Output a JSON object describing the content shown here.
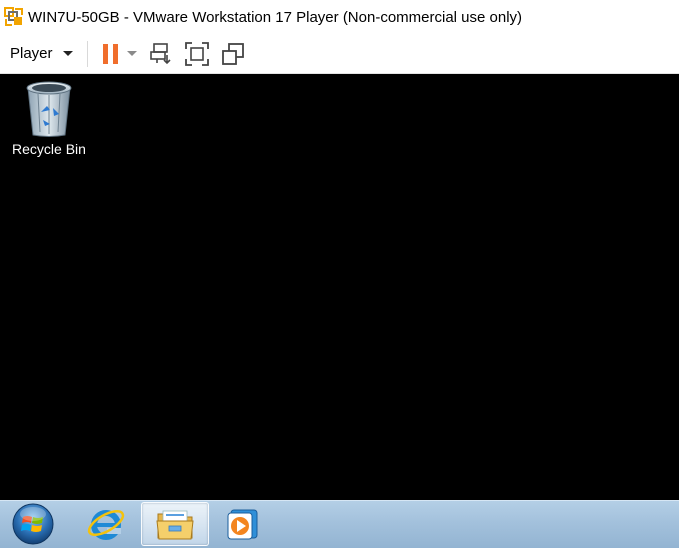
{
  "window": {
    "title": "WIN7U-50GB - VMware Workstation 17 Player (Non-commercial use only)",
    "app_icon": "vmware-player-icon"
  },
  "toolbar": {
    "player_menu_label": "Player",
    "buttons": [
      {
        "name": "pause-button",
        "icon": "pause-icon",
        "color": "#f06e2c"
      },
      {
        "name": "pause-dropdown-button",
        "icon": "chevron-down-icon"
      },
      {
        "name": "send-ctrl-alt-del-button",
        "icon": "ctrl-alt-del-icon"
      },
      {
        "name": "full-screen-button",
        "icon": "fullscreen-icon"
      },
      {
        "name": "unity-button",
        "icon": "unity-icon"
      }
    ]
  },
  "vm": {
    "desktop_background": "#000000",
    "desktop_icons": [
      {
        "label": "Recycle Bin",
        "icon": "recycle-bin-icon"
      }
    ]
  },
  "taskbar": {
    "items": [
      {
        "name": "start-button",
        "icon": "windows-start-orb-icon"
      },
      {
        "name": "internet-explorer-button",
        "icon": "internet-explorer-icon"
      },
      {
        "name": "windows-explorer-button",
        "icon": "folder-icon",
        "active": true
      },
      {
        "name": "windows-media-player-button",
        "icon": "media-player-icon"
      }
    ]
  },
  "colors": {
    "accent": "#f06e2c",
    "taskbar": "#a3c1dc"
  }
}
